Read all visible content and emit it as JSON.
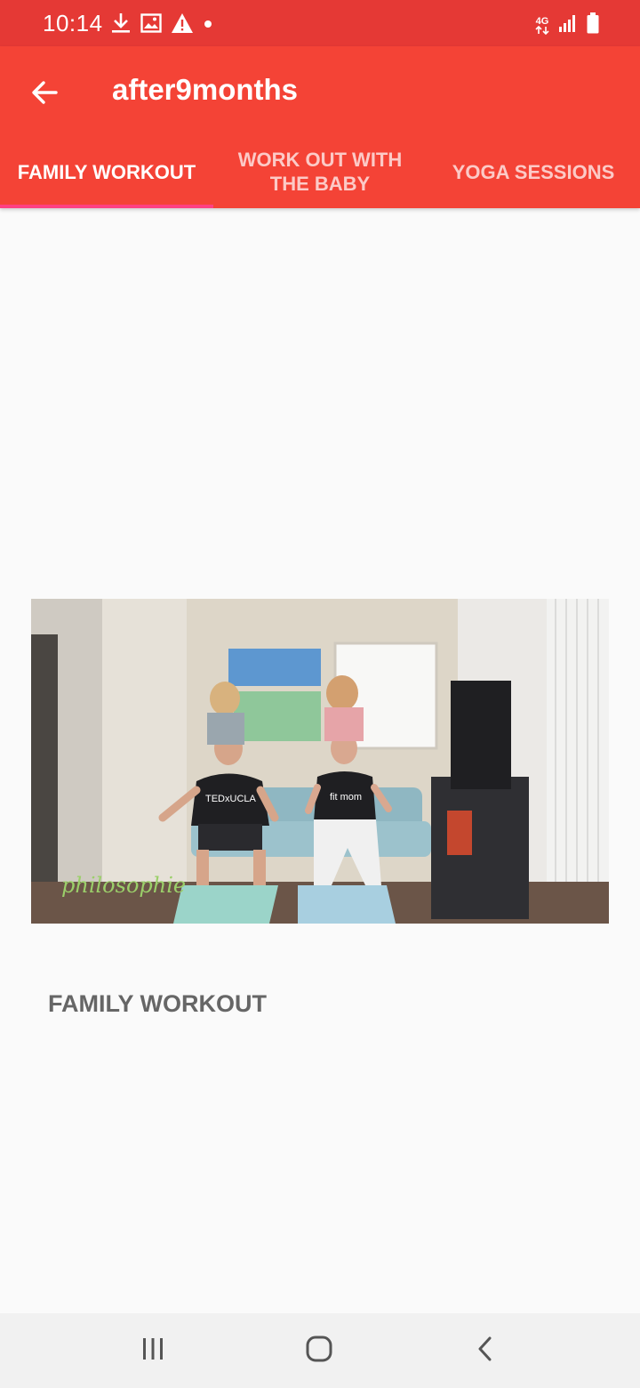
{
  "status_bar": {
    "time": "10:14",
    "network": "4G",
    "icons_left": [
      "download-icon",
      "image-icon",
      "warning-icon",
      "dot-icon"
    ],
    "icons_right": [
      "network-4g-icon",
      "signal-icon",
      "battery-icon"
    ]
  },
  "app_bar": {
    "title": "after9months",
    "back_icon": "arrow-left-icon",
    "color": "#f44336",
    "status_color": "#e53935"
  },
  "tabs": [
    {
      "label": "FAMILY WORKOUT",
      "active": true
    },
    {
      "label": "WORK OUT WITH THE BABY",
      "active": false
    },
    {
      "label": "YOGA SESSIONS",
      "active": false
    }
  ],
  "tab_indicator_color": "#ff4081",
  "content": {
    "video_thumbnail": {
      "watermark": "philosophie",
      "shirt_text_left": "TEDxUCLA",
      "shirt_text_right": "fit mom"
    },
    "section_title": "FAMILY WORKOUT"
  },
  "nav_bar": {
    "buttons": [
      "recent-apps-icon",
      "home-icon",
      "back-icon"
    ]
  }
}
